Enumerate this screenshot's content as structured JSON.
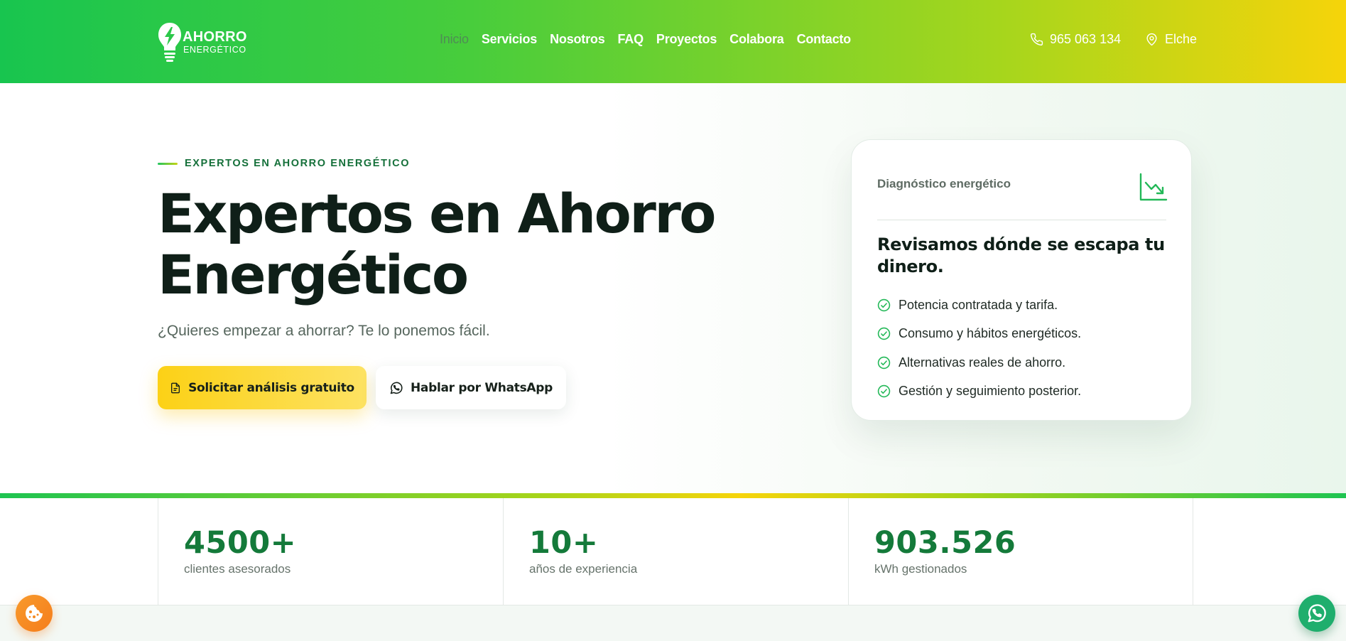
{
  "brand": {
    "name_line1": "AHORRO",
    "name_line2": "ENERGÉTICO"
  },
  "nav": {
    "items": [
      {
        "label": "Inicio",
        "active": true
      },
      {
        "label": "Servicios"
      },
      {
        "label": "Nosotros"
      },
      {
        "label": "FAQ"
      },
      {
        "label": "Proyectos"
      },
      {
        "label": "Colabora"
      },
      {
        "label": "Contacto"
      }
    ]
  },
  "contact": {
    "phone": "965 063 134",
    "location": "Elche",
    "phone_icon": "phone-icon",
    "location_icon": "map-pin-icon"
  },
  "hero": {
    "eyebrow": "EXPERTOS EN AHORRO ENERGÉTICO",
    "title_line1": "Expertos en Ahorro",
    "title_line2": "Energético",
    "subtitle": "¿Quieres empezar a ahorrar? Te lo ponemos fácil.",
    "primary_button": "Solicitar análisis gratuito",
    "secondary_button": "Hablar por WhatsApp"
  },
  "card": {
    "heading": "Diagnóstico energético",
    "title": "Revisamos dónde se escapa tu dinero.",
    "items": [
      "Potencia contratada y tarifa.",
      "Consumo y hábitos energéticos.",
      "Alternativas reales de ahorro.",
      "Gestión y seguimiento posterior."
    ]
  },
  "stats": [
    {
      "value": "4500+",
      "label": "clientes asesorados"
    },
    {
      "value": "10+",
      "label": "años de experiencia"
    },
    {
      "value": "903.526",
      "label": "kWh gestionados"
    }
  ],
  "colors": {
    "brand_green": "#18c54f",
    "brand_yellow": "#f6d40a",
    "stat_green": "#147a3a",
    "button_yellow": "#fcd116"
  }
}
